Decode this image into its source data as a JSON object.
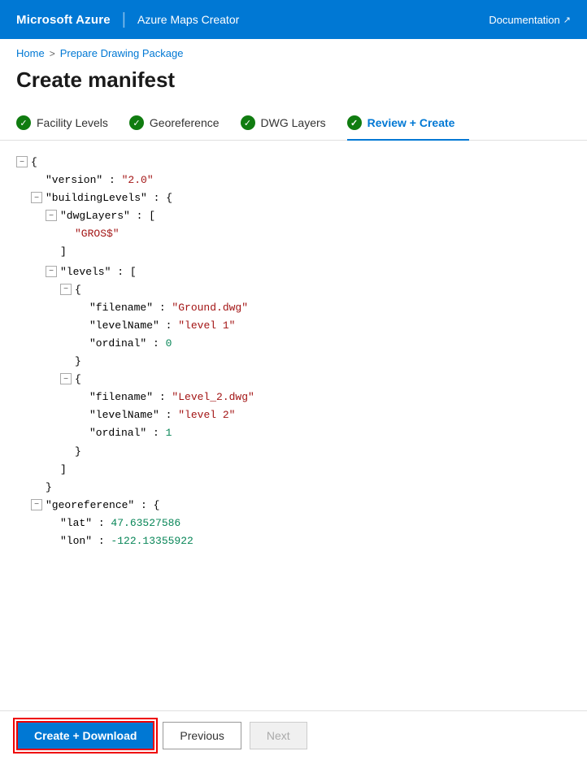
{
  "header": {
    "brand": "Microsoft Azure",
    "divider": "|",
    "product": "Azure Maps Creator",
    "docs_label": "Documentation",
    "docs_icon": "↗"
  },
  "breadcrumb": {
    "home": "Home",
    "separator": ">",
    "current": "Prepare Drawing Package"
  },
  "page": {
    "title": "Create manifest"
  },
  "steps": [
    {
      "id": "facility-levels",
      "label": "Facility Levels",
      "completed": true,
      "active": false
    },
    {
      "id": "georeference",
      "label": "Georeference",
      "completed": true,
      "active": false
    },
    {
      "id": "dwg-layers",
      "label": "DWG Layers",
      "completed": true,
      "active": false
    },
    {
      "id": "review-create",
      "label": "Review + Create",
      "completed": false,
      "active": true
    }
  ],
  "footer": {
    "create_download": "Create + Download",
    "previous": "Previous",
    "next": "Next"
  },
  "collapse_symbol": "−",
  "json_data": {
    "version": "2.0",
    "buildingLevels": {
      "dwgLayers": [
        "GROS$"
      ],
      "levels": [
        {
          "filename": "Ground.dwg",
          "levelName": "level 1",
          "ordinal": 0
        },
        {
          "filename": "Level_2.dwg",
          "levelName": "level 2",
          "ordinal": 1
        }
      ]
    },
    "georeference": {
      "lat": 47.63527586,
      "lon": -122.13355922
    }
  }
}
